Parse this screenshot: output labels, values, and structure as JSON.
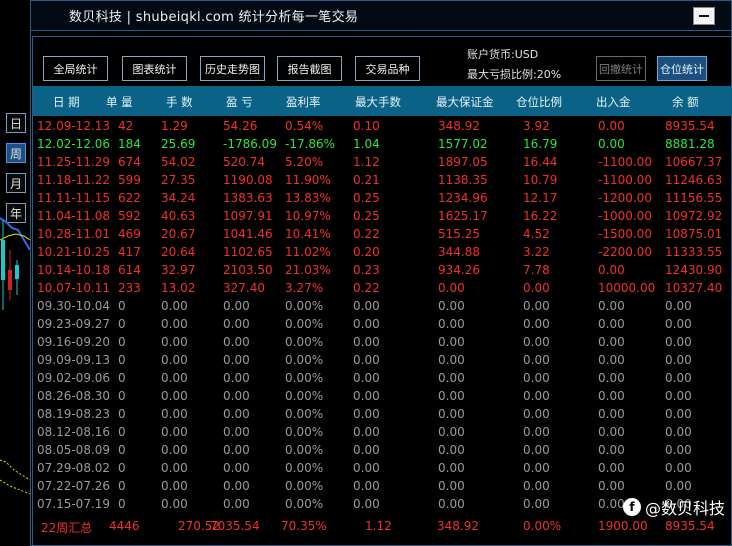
{
  "side_tabs": [
    "日",
    "周",
    "月",
    "年"
  ],
  "window": {
    "title": "数贝科技 | shubeiqkl.com 统计分析每一笔交易"
  },
  "toolbar": {
    "buttons": [
      "全局统计",
      "图表统计",
      "历史走势图",
      "报告截图",
      "交易品种"
    ],
    "account_currency": "账户货币:USD",
    "max_loss_ratio": "最大亏损比例:20%",
    "withdraw_stats": "回撤统计",
    "position_stats": "仓位统计"
  },
  "columns": [
    "日 期",
    "单 量",
    "手 数",
    "盈 亏",
    "盈利率",
    "最大手数",
    "最大保证金",
    "仓位比例",
    "出入金",
    "余 额"
  ],
  "rows": [
    {
      "c": "red",
      "v": [
        "12.09-12.13",
        "42",
        "1.29",
        "54.26",
        "0.54%",
        "0.10",
        "348.92",
        "3.92",
        "0.00",
        "8935.54"
      ]
    },
    {
      "c": "green",
      "v": [
        "12.02-12.06",
        "184",
        "25.69",
        "-1786.09",
        "-17.86%",
        "1.04",
        "1577.02",
        "16.79",
        "0.00",
        "8881.28"
      ]
    },
    {
      "c": "red",
      "v": [
        "11.25-11.29",
        "674",
        "54.02",
        "520.74",
        "5.20%",
        "1.12",
        "1897.05",
        "16.44",
        "-1100.00",
        "10667.37"
      ]
    },
    {
      "c": "red",
      "v": [
        "11.18-11.22",
        "599",
        "27.35",
        "1190.08",
        "11.90%",
        "0.21",
        "1138.35",
        "10.79",
        "-1100.00",
        "11246.63"
      ]
    },
    {
      "c": "red",
      "v": [
        "11.11-11.15",
        "622",
        "34.24",
        "1383.63",
        "13.83%",
        "0.25",
        "1234.96",
        "12.17",
        "-1200.00",
        "11156.55"
      ]
    },
    {
      "c": "red",
      "v": [
        "11.04-11.08",
        "592",
        "40.63",
        "1097.91",
        "10.97%",
        "0.25",
        "1625.17",
        "16.22",
        "-1000.00",
        "10972.92"
      ]
    },
    {
      "c": "red",
      "v": [
        "10.28-11.01",
        "469",
        "20.67",
        "1041.46",
        "10.41%",
        "0.22",
        "515.25",
        "4.52",
        "-1500.00",
        "10875.01"
      ]
    },
    {
      "c": "red",
      "v": [
        "10.21-10.25",
        "417",
        "20.64",
        "1102.65",
        "11.02%",
        "0.20",
        "344.88",
        "3.22",
        "-2200.00",
        "11333.55"
      ]
    },
    {
      "c": "red",
      "v": [
        "10.14-10.18",
        "614",
        "32.97",
        "2103.50",
        "21.03%",
        "0.23",
        "934.26",
        "7.78",
        "0.00",
        "12430.90"
      ]
    },
    {
      "c": "red",
      "v": [
        "10.07-10.11",
        "233",
        "13.02",
        "327.40",
        "3.27%",
        "0.22",
        "0.00",
        "0.00",
        "10000.00",
        "10327.40"
      ]
    },
    {
      "c": "gray",
      "v": [
        "09.30-10.04",
        "0",
        "0.00",
        "0.00",
        "0.00%",
        "0.00",
        "0.00",
        "0.00",
        "0.00",
        "0.00"
      ]
    },
    {
      "c": "gray",
      "v": [
        "09.23-09.27",
        "0",
        "0.00",
        "0.00",
        "0.00%",
        "0.00",
        "0.00",
        "0.00",
        "0.00",
        "0.00"
      ]
    },
    {
      "c": "gray",
      "v": [
        "09.16-09.20",
        "0",
        "0.00",
        "0.00",
        "0.00%",
        "0.00",
        "0.00",
        "0.00",
        "0.00",
        "0.00"
      ]
    },
    {
      "c": "gray",
      "v": [
        "09.09-09.13",
        "0",
        "0.00",
        "0.00",
        "0.00%",
        "0.00",
        "0.00",
        "0.00",
        "0.00",
        "0.00"
      ]
    },
    {
      "c": "gray",
      "v": [
        "09.02-09.06",
        "0",
        "0.00",
        "0.00",
        "0.00%",
        "0.00",
        "0.00",
        "0.00",
        "0.00",
        "0.00"
      ]
    },
    {
      "c": "gray",
      "v": [
        "08.26-08.30",
        "0",
        "0.00",
        "0.00",
        "0.00%",
        "0.00",
        "0.00",
        "0.00",
        "0.00",
        "0.00"
      ]
    },
    {
      "c": "gray",
      "v": [
        "08.19-08.23",
        "0",
        "0.00",
        "0.00",
        "0.00%",
        "0.00",
        "0.00",
        "0.00",
        "0.00",
        "0.00"
      ]
    },
    {
      "c": "gray",
      "v": [
        "08.12-08.16",
        "0",
        "0.00",
        "0.00",
        "0.00%",
        "0.00",
        "0.00",
        "0.00",
        "0.00",
        "0.00"
      ]
    },
    {
      "c": "gray",
      "v": [
        "08.05-08.09",
        "0",
        "0.00",
        "0.00",
        "0.00%",
        "0.00",
        "0.00",
        "0.00",
        "0.00",
        "0.00"
      ]
    },
    {
      "c": "gray",
      "v": [
        "07.29-08.02",
        "0",
        "0.00",
        "0.00",
        "0.00%",
        "0.00",
        "0.00",
        "0.00",
        "0.00",
        "0.00"
      ]
    },
    {
      "c": "gray",
      "v": [
        "07.22-07.26",
        "0",
        "0.00",
        "0.00",
        "0.00%",
        "0.00",
        "0.00",
        "0.00",
        "0.00",
        "0.00"
      ]
    },
    {
      "c": "gray",
      "v": [
        "07.15-07.19",
        "0",
        "0.00",
        "0.00",
        "0.00%",
        "0.00",
        "0.00",
        "0.00",
        "0.00",
        "0.00"
      ]
    }
  ],
  "summary": [
    "22周汇总",
    "4446",
    "270.52",
    "7035.54",
    "70.35%",
    "1.12",
    "348.92",
    "0.00%",
    "1900.00",
    "8935.54"
  ],
  "watermark": "@数贝科技",
  "colors": {
    "profit": "#f0312a",
    "loss": "#2be63a",
    "header_bg": "#0a6286",
    "accent_button": "#1a4f7e"
  }
}
